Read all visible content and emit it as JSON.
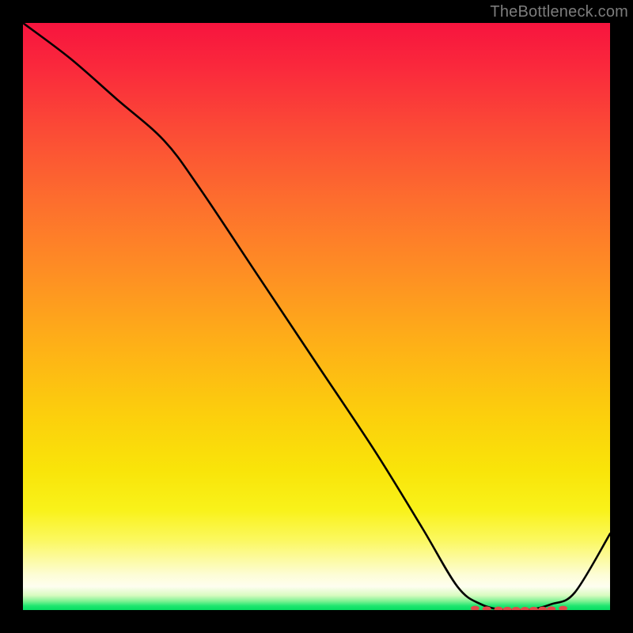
{
  "watermark": "TheBottleneck.com",
  "chart_data": {
    "type": "line",
    "title": "",
    "xlabel": "",
    "ylabel": "",
    "xlim": [
      0,
      100
    ],
    "ylim": [
      0,
      100
    ],
    "series": [
      {
        "name": "bottleneck-curve",
        "x": [
          0,
          8,
          16,
          24,
          30,
          40,
          50,
          60,
          68,
          74,
          78,
          82,
          86,
          90,
          94,
          100
        ],
        "y": [
          100,
          94,
          87,
          80,
          72,
          57,
          42,
          27,
          14,
          4,
          1,
          0,
          0,
          1,
          3,
          13
        ]
      }
    ],
    "markers": {
      "name": "optimal-range-markers",
      "x": [
        77,
        79,
        81,
        82.5,
        84,
        85.5,
        87,
        88.5,
        90,
        92
      ],
      "y": [
        0.3,
        0.2,
        0.15,
        0.12,
        0.1,
        0.1,
        0.12,
        0.15,
        0.2,
        0.3
      ]
    },
    "colors": {
      "curve": "#000000",
      "marker": "#e24a4a",
      "gradient_top": "#f7143e",
      "gradient_mid": "#fccd0d",
      "gradient_bottom": "#07dd62"
    }
  }
}
